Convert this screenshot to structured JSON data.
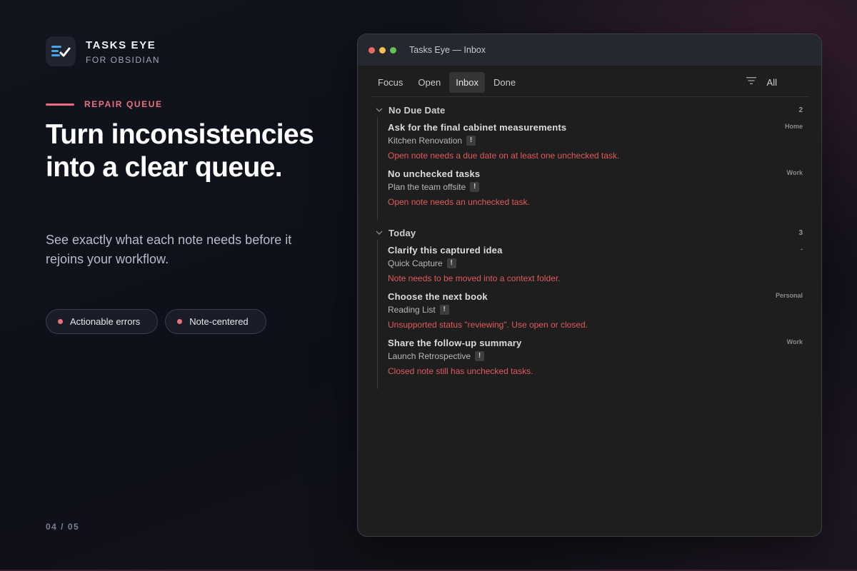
{
  "brand": {
    "name": "TASKS EYE",
    "sub": "FOR OBSIDIAN"
  },
  "eyebrow": "REPAIR QUEUE",
  "headline": "Turn inconsistencies into a clear queue.",
  "lede": "See exactly what each note needs before it rejoins your workflow.",
  "chips": [
    "Actionable errors",
    "Note-centered"
  ],
  "pager": "04 / 05",
  "window": {
    "title": "Tasks Eye — Inbox",
    "tabs": [
      {
        "label": "Focus",
        "active": false
      },
      {
        "label": "Open",
        "active": false
      },
      {
        "label": "Inbox",
        "active": true
      },
      {
        "label": "Done",
        "active": false
      }
    ],
    "filter_label": "All",
    "groups": [
      {
        "title": "No Due Date",
        "count": "2",
        "tasks": [
          {
            "title": "Ask for the final cabinet measurements",
            "tag": "Home",
            "note": "Kitchen Renovation",
            "error": "Open note needs a due date on at least one unchecked task."
          },
          {
            "title": "No unchecked tasks",
            "tag": "Work",
            "note": "Plan the team offsite",
            "error": "Open note needs an unchecked task."
          }
        ]
      },
      {
        "title": "Today",
        "count": "3",
        "tasks": [
          {
            "title": "Clarify this captured idea",
            "tag": "-",
            "note": "Quick Capture",
            "error": "Note needs to be moved into a context folder."
          },
          {
            "title": "Choose the next book",
            "tag": "Personal",
            "note": "Reading List",
            "error": "Unsupported status \"reviewing\". Use open or closed."
          },
          {
            "title": "Share the follow-up summary",
            "tag": "Work",
            "note": "Launch Retrospective",
            "error": "Closed note still has unchecked tasks."
          }
        ]
      }
    ],
    "bang": "!"
  },
  "colors": {
    "accent": "#e8707e",
    "error": "#e05a5a",
    "traffic_red": "#ed6a5e",
    "traffic_yellow": "#f5bf4f",
    "traffic_green": "#61c554",
    "logo_blue": "#4aa3e8"
  }
}
